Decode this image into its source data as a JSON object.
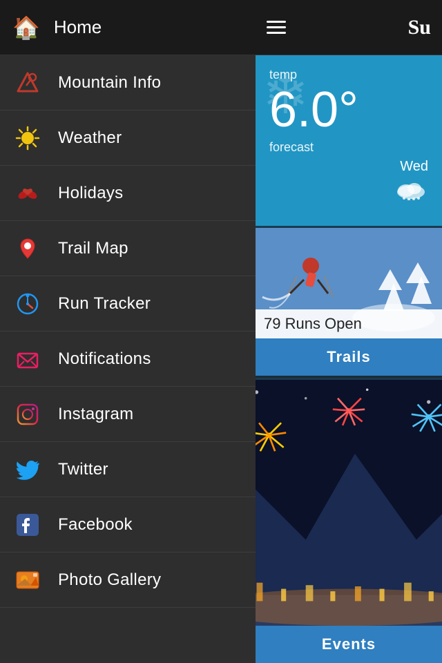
{
  "header": {
    "home_label": "Home",
    "hamburger_aria": "menu",
    "brand": "Su"
  },
  "nav": {
    "items": [
      {
        "id": "mountain-info",
        "label": "Mountain Info",
        "icon": "⛷",
        "icon_color": "icon-red"
      },
      {
        "id": "weather",
        "label": "Weather",
        "icon": "☀",
        "icon_color": "icon-yellow"
      },
      {
        "id": "holidays",
        "label": "Holidays",
        "icon": "❄",
        "icon_color": "icon-red"
      },
      {
        "id": "trail-map",
        "label": "Trail Map",
        "icon": "📍",
        "icon_color": "icon-red"
      },
      {
        "id": "run-tracker",
        "label": "Run Tracker",
        "icon": "⏱",
        "icon_color": "icon-blue"
      },
      {
        "id": "notifications",
        "label": "Notifications",
        "icon": "✉",
        "icon_color": "icon-pink"
      },
      {
        "id": "instagram",
        "label": "Instagram",
        "icon": "📷",
        "icon_color": "icon-instagram"
      },
      {
        "id": "twitter",
        "label": "Twitter",
        "icon": "🐦",
        "icon_color": "icon-twitter"
      },
      {
        "id": "facebook",
        "label": "Facebook",
        "icon": "f",
        "icon_color": "icon-fb"
      },
      {
        "id": "photo-gallery",
        "label": "Photo Gallery",
        "icon": "🖼",
        "icon_color": "icon-photo"
      }
    ]
  },
  "weather_card": {
    "temp_label": "temp",
    "temp_value": "6.0°",
    "forecast_label": "forecast",
    "forecast_day": "Wed",
    "snowflake": "❄"
  },
  "trails_card": {
    "runs_open": "79 Runs Open",
    "button_label": "Trails"
  },
  "events_card": {
    "button_label": "Events"
  }
}
